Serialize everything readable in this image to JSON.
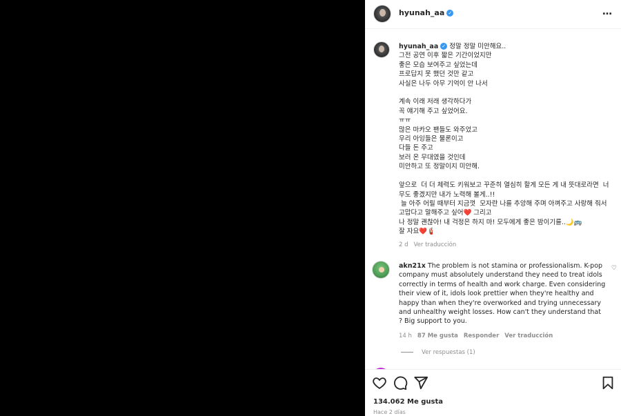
{
  "post": {
    "username": "hyunah_aa",
    "verified_badge": "verified-badge",
    "more_icon": "…"
  },
  "caption": {
    "username": "hyunah_aa",
    "text": "정말 정말 미안해요..\n그전 공연 이후 짧은 기간이었지만\n좋은 모습 보여주고 싶었는데\n프로답지 못 했던 것만 같고\n사실은 나두 아무 기억이 안 나서\n\n계속 이래 저래 생각하다가\n꼭 얘기해 주고 싶었어요.\nㅠㅠ\n많은 마카오 팬들도 와주었고\n우리 아잉들은 물론이고\n다들 돈 주고\n보러 온 무대였을 것인데\n미안하고 또 정말이지 미안해.\n\n앞으로  더 더 체력도 키워보고 꾸준히 열심히 할게 모든 게 내 뜻대로라면  너무도 좋겠지만 내가 노력해 볼게..!!\n 늘 아주 어릴 때부터 지금껏  모자란 나를 추앙해 주며 아껴주고 사랑해 줘서 고맙다고 말해주고 싶어❤️ 그리고\n나 정말 괜찮아! 내 걱정은 하지 마! 모두에게 좋은 밤이기를..🌙🚌\n잘 자요❤️🧯",
    "age": "2 d",
    "translate": "Ver traducción"
  },
  "comment": {
    "username": "akn21x",
    "text": "The problem is not stamina or professionalism. K-pop company must absolutely understand they need to treat idols correctly in terms of health and work charge. Even considering their view of it, idols look prettier when they're healthy and happy than when they're overworked and trying unnecessary and unhealthy weight losses. How can't they understand that ? Big support to you.",
    "age": "14 h",
    "likes": "87 Me gusta",
    "reply": "Responder",
    "translate": "Ver traducción",
    "view_replies": "Ver respuestas (1)"
  },
  "actions": {
    "like_icon": "heart-icon",
    "comment_icon": "comment-icon",
    "share_icon": "share-icon",
    "save_icon": "bookmark-icon",
    "likes": "134.062 Me gusta",
    "posted": "Hace 2 días"
  },
  "colors": {
    "verified": "#3897f0",
    "meta": "#8e8e8e",
    "text": "#262626",
    "media_bg": "#000000"
  }
}
